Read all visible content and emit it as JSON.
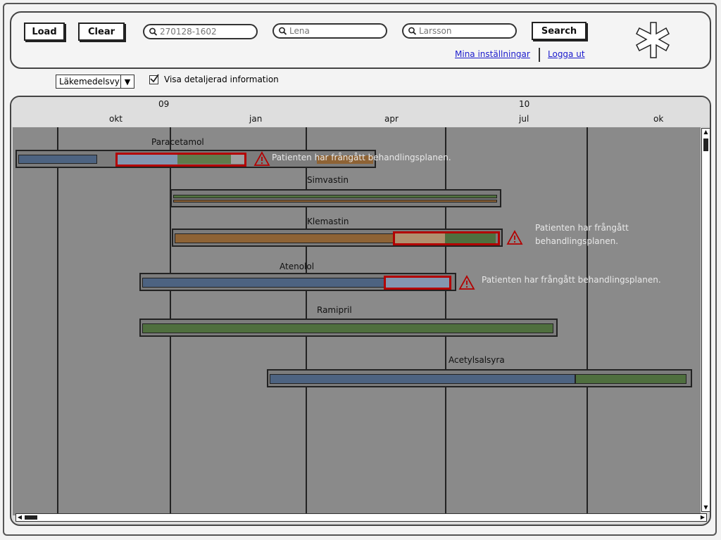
{
  "header": {
    "load_label": "Load",
    "clear_label": "Clear",
    "search_label": "Search",
    "personnummer_placeholder": "270128-1602",
    "firstname_placeholder": "Lena",
    "lastname_placeholder": "Larsson",
    "settings_link": "Mina inställningar",
    "logout_link": "Logga ut",
    "logo_icon": "asterisk-logo-icon"
  },
  "toolbar": {
    "view_select_value": "Läkemedelsvy",
    "detail_checkbox_label": "Visa detaljerad information",
    "detail_checked": true
  },
  "timeline": {
    "years": [
      "09",
      "10"
    ],
    "months": [
      "okt",
      "jan",
      "apr",
      "jul",
      "ok"
    ],
    "drugs": [
      {
        "name": "Paracetamol",
        "warning": "Patienten har frångått behandlingsplanen."
      },
      {
        "name": "Simvastin"
      },
      {
        "name": "Klemastin",
        "warning_line1": "Patienten har frångått",
        "warning_line2": "behandlingsplanen."
      },
      {
        "name": "Atenolol",
        "warning": "Patienten har frångått behandlingsplanen."
      },
      {
        "name": "Ramipril"
      },
      {
        "name": "Acetylsalsyra"
      }
    ]
  },
  "colors": {
    "blue_segment": "#4d6381",
    "green_segment": "#4f6f3e",
    "orange_segment": "#8e6335",
    "alert_red": "#b30000"
  }
}
